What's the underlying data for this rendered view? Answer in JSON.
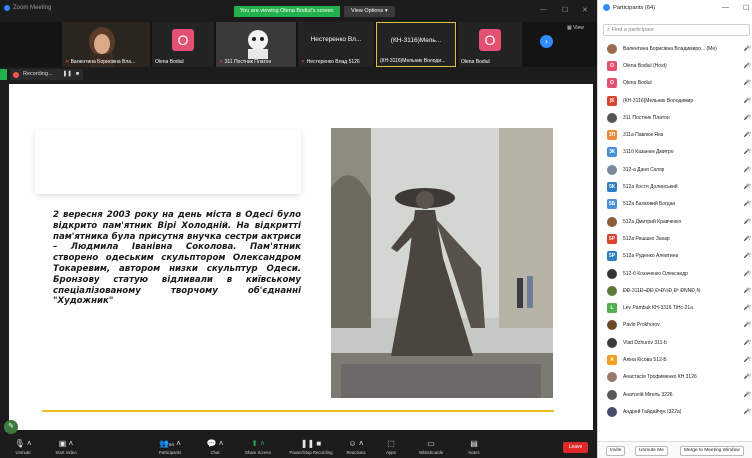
{
  "window": {
    "title": "Zoom Meeting",
    "viewing_banner": "You are viewing Olena Bodiul's screen",
    "view_options": "View Options",
    "view_label": "View"
  },
  "videos": [
    {
      "name": "Валентина Борисівна Вла...",
      "type": "photo"
    },
    {
      "name": "Olena Bodiul",
      "initial": "O"
    },
    {
      "name": "311 Постник Платон",
      "type": "photo"
    },
    {
      "name": "Нестеренко Влад 5126",
      "text": "Нестеренко Вл..."
    },
    {
      "name": "(КН-3116)Мельник Володи...",
      "text": "(КН-3116)Мель..."
    },
    {
      "name": "Olena Bodiul",
      "initial": "O"
    }
  ],
  "recording": {
    "label": "Recording..."
  },
  "slide": {
    "text": "2 вересня 2003 року на день міста в Одесі було відкрито пам'ятник Вірі Холодній. На відкритті пам'ятника була присутня внучка сестри актриси – Людмила Іванівна Соколова. Пам'ятник створено одеським скульптором Олександром Токаревим, автором низки скульптур Одеси. Бронзову статую відливали в київському спеціалізованому творчому об'єднанні \"Художник\""
  },
  "toolbar": {
    "unmute": "Unmute",
    "start_video": "Start Video",
    "participants": "Participants",
    "participants_count": "64",
    "chat": "Chat",
    "share_screen": "Share Screen",
    "pause_recording": "Pause/Stop Recording",
    "reactions": "Reactions",
    "apps": "Apps",
    "whiteboards": "Whiteboards",
    "notes": "Notes",
    "leave": "Leave"
  },
  "panel": {
    "title": "Participants (64)",
    "search_placeholder": "Find a participant",
    "participants": [
      {
        "name": "Валентина Борисівна Владимиро... (Me)",
        "avatar": "photo",
        "color": "#9b6b4f"
      },
      {
        "name": "Olena Bodiul (Host)",
        "avatar": "O",
        "color": "#e4506f"
      },
      {
        "name": "Olena Bodiul",
        "avatar": "O",
        "color": "#e4506f"
      },
      {
        "name": "(КН-3116)Мельник Володимир",
        "avatar": "(К",
        "color": "#d9432f"
      },
      {
        "name": "311 Постник Платон",
        "avatar": "photo",
        "color": "#555555"
      },
      {
        "name": "311а Павлюк Яна",
        "avatar": "3П",
        "color": "#e98a3c"
      },
      {
        "name": "311б Казанюк Дмитро",
        "avatar": "3К",
        "color": "#4a90d9"
      },
      {
        "name": "312-а Даня Скляр",
        "avatar": "photo",
        "color": "#7a8a9a"
      },
      {
        "name": "512а Костя Долинський",
        "avatar": "5К",
        "color": "#2f7fc1"
      },
      {
        "name": "512а Балковий Богдан",
        "avatar": "5Б",
        "color": "#4a90d9"
      },
      {
        "name": "512а Дмитрий Кравченко",
        "avatar": "photo",
        "color": "#8a5a3a"
      },
      {
        "name": "512а Решшко Захар",
        "avatar": "5Р",
        "color": "#d9432f"
      },
      {
        "name": "512а Руденко Алевтина",
        "avatar": "5Р",
        "color": "#2f7fc1"
      },
      {
        "name": "512-б Козаченко Олександр",
        "avatar": "photo",
        "color": "#333333"
      },
      {
        "name": "ÐÐ-311Ð¬ÐÐ¸Ð¹Ð½Ð¸Ðº ÐÑÑÐ¸Ñ",
        "avatar": "photo",
        "color": "#5a7a3a"
      },
      {
        "name": "Lev Pambuk КН-3316 TiHc-21a",
        "avatar": "L",
        "color": "#4caf50"
      },
      {
        "name": "Pavlo Prokhorov",
        "avatar": "photo",
        "color": "#6b4a2a"
      },
      {
        "name": "Vlad Dzhurov 311-b",
        "avatar": "photo",
        "color": "#3a3a3a"
      },
      {
        "name": "Аліна Кісова 512-Б",
        "avatar": "А",
        "color": "#f0a020"
      },
      {
        "name": "Анастасія Трофименко КН 3126",
        "avatar": "photo",
        "color": "#9a7a6a"
      },
      {
        "name": "Анатолій Мігель 3226",
        "avatar": "photo",
        "color": "#5a5a5a"
      },
      {
        "name": "Андрей Гайдайчук (322а)",
        "avatar": "photo",
        "color": "#4a4a6a"
      }
    ],
    "invite": "Invite",
    "unmute_me": "Unmute Me",
    "merge": "Merge to Meeting Window"
  }
}
